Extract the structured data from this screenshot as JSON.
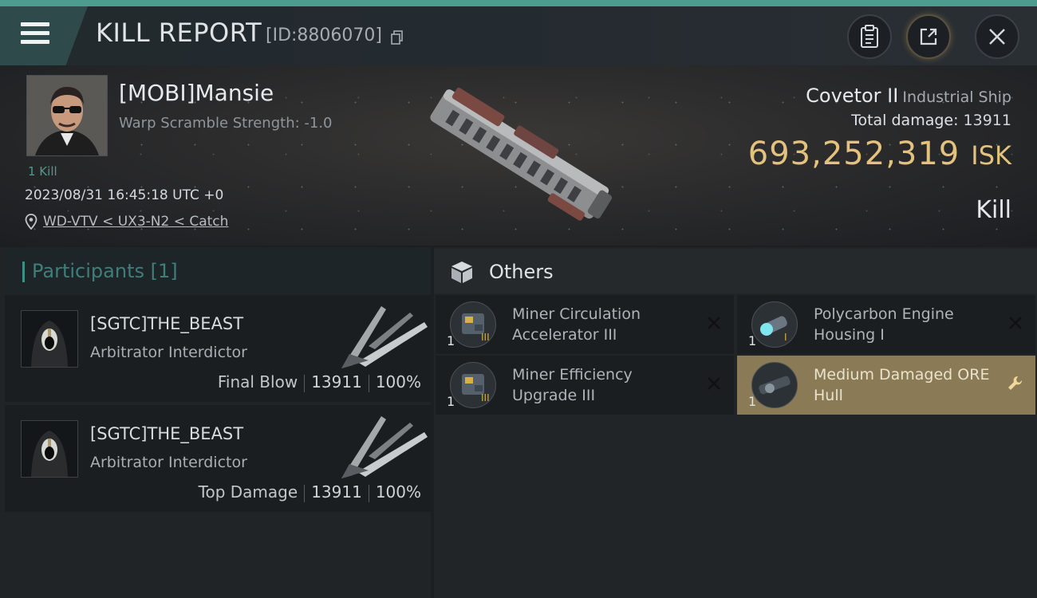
{
  "header": {
    "title": "KILL REPORT",
    "report_id": "[ID:8806070]"
  },
  "victim": {
    "name": "[MOBI]Mansie",
    "warp_scramble": "Warp Scramble Strength: -1.0",
    "kill_count": "1 Kill",
    "datetime": "2023/08/31 16:45:18 UTC +0",
    "location": "WD-VTV < UX3-N2 < Catch",
    "ship_name": "Covetor II",
    "ship_class": "Industrial Ship",
    "total_damage_label": "Total damage:",
    "total_damage": "13911",
    "isk_value": "693,252,319",
    "isk_unit": "ISK",
    "report_type": "Kill"
  },
  "participants": {
    "title": "Participants",
    "count": "[1]",
    "rows": [
      {
        "name": "[SGTC]THE_BEAST",
        "ship": "Arbitrator Interdictor",
        "role": "Final Blow",
        "damage": "13911",
        "percent": "100%"
      },
      {
        "name": "[SGTC]THE_BEAST",
        "ship": "Arbitrator Interdictor",
        "role": "Top Damage",
        "damage": "13911",
        "percent": "100%"
      }
    ]
  },
  "others": {
    "title": "Others",
    "items": [
      {
        "qty": "1",
        "name": "Miner Circulation Accelerator III",
        "tier": "III",
        "status": "destroyed"
      },
      {
        "qty": "1",
        "name": "Polycarbon Engine Housing I",
        "tier": "I",
        "status": "destroyed"
      },
      {
        "qty": "1",
        "name": "Miner Efficiency Upgrade III",
        "tier": "III",
        "status": "destroyed"
      },
      {
        "qty": "1",
        "name": "Medium Damaged ORE Hull",
        "tier": "",
        "status": "dropped"
      }
    ]
  },
  "colors": {
    "accent": "#4c9d8f",
    "isk": "#e3c27e",
    "dropped_bg": "#8a7a55"
  },
  "icons": [
    "menu-icon",
    "copy-icon",
    "clipboard-icon",
    "share-icon",
    "close-icon",
    "location-pin-icon",
    "box-icon",
    "destroyed-x-icon",
    "wrench-icon"
  ]
}
